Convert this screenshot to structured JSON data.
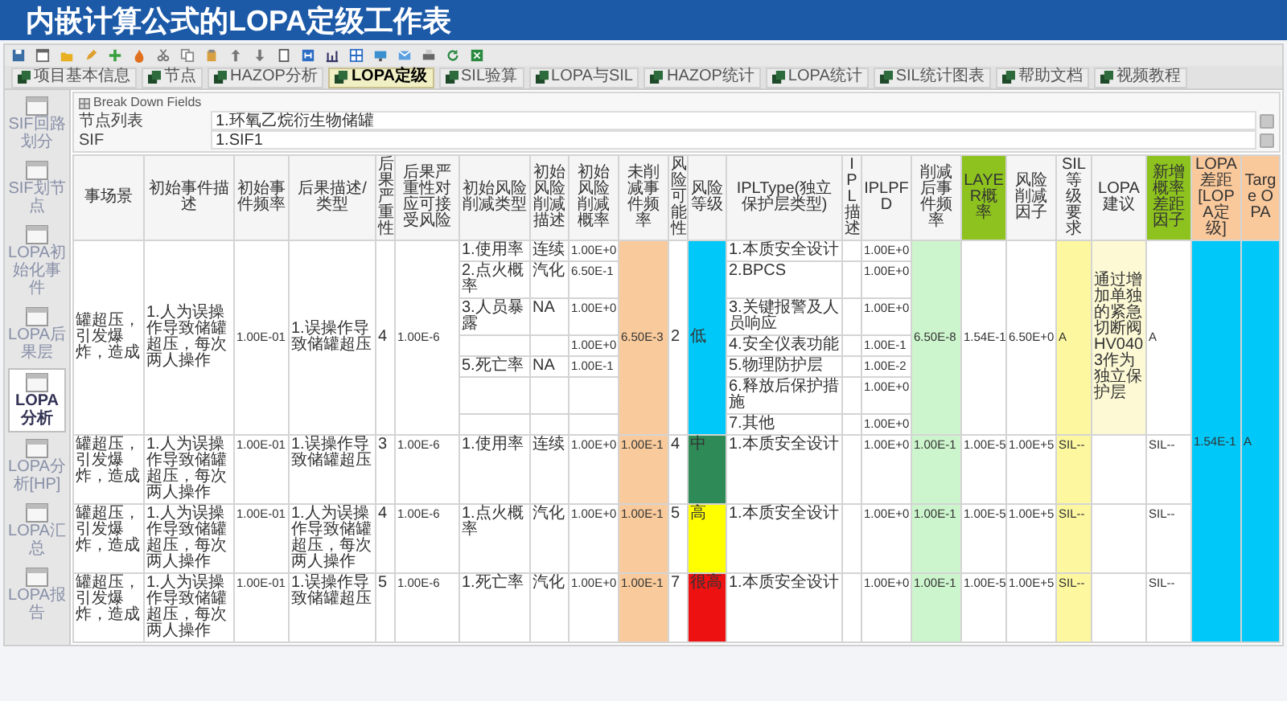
{
  "title": "内嵌计算公式的LOPA定级工作表",
  "tabs": [
    {
      "label": "项目基本信息",
      "selected": false
    },
    {
      "label": "节点",
      "selected": false
    },
    {
      "label": "HAZOP分析",
      "selected": false
    },
    {
      "label": "LOPA定级",
      "selected": true
    },
    {
      "label": "SIL验算",
      "selected": false
    },
    {
      "label": "LOPA与SIL",
      "selected": false
    },
    {
      "label": "HAZOP统计",
      "selected": false
    },
    {
      "label": "LOPA统计",
      "selected": false
    },
    {
      "label": "SIL统计图表",
      "selected": false
    },
    {
      "label": "帮助文档",
      "selected": false
    },
    {
      "label": "视频教程",
      "selected": false
    }
  ],
  "sidebar": {
    "items": [
      {
        "label": "SIF回路划分",
        "selected": false
      },
      {
        "label": "SIF划节点",
        "selected": false
      },
      {
        "label": "LOPA初始化事件",
        "selected": false
      },
      {
        "label": "LOPA后果层",
        "selected": false
      },
      {
        "label": "LOPA分析",
        "selected": true
      },
      {
        "label": "LOPA分析[HP]",
        "selected": false
      },
      {
        "label": "LOPA汇总",
        "selected": false
      },
      {
        "label": "LOPA报告",
        "selected": false
      }
    ]
  },
  "breakdown": {
    "title": "Break Down Fields",
    "fields": [
      {
        "label": "节点列表",
        "value": "1.环氧乙烷衍生物储罐"
      },
      {
        "label": "SIF",
        "value": "1.SIF1"
      }
    ]
  },
  "table": {
    "columns": [
      {
        "label": "事场景",
        "kind": "text"
      },
      {
        "label": "初始事件描述",
        "kind": "text"
      },
      {
        "label": "初始事件频率",
        "kind": "number"
      },
      {
        "label": "后果描述/类型",
        "kind": "text"
      },
      {
        "label": "后果严重性",
        "kind": "text"
      },
      {
        "label": "后果严重性对应可接受风险",
        "kind": "number"
      },
      {
        "label": "初始风险削减类型",
        "kind": "text"
      },
      {
        "label": "初始风险削减描述",
        "kind": "text"
      },
      {
        "label": "初始风险削减概率",
        "kind": "number"
      },
      {
        "label": "未削减事件频率",
        "kind": "unmitigated"
      },
      {
        "label": "风险可能性",
        "kind": "text"
      },
      {
        "label": "风险等级",
        "kind": "risk"
      },
      {
        "label": "IPLType(独立保护层类型)",
        "kind": "text"
      },
      {
        "label": "IPL描述",
        "kind": "text"
      },
      {
        "label": "IPLPFD",
        "kind": "number"
      },
      {
        "label": "削减后事件频率",
        "kind": "mitigated"
      },
      {
        "label": "LAYER概率",
        "kind": "flag"
      },
      {
        "label": "风险削减因子",
        "kind": "number"
      },
      {
        "label": "SIL等级要求",
        "kind": "sil"
      },
      {
        "label": "LOPA建议",
        "kind": "advice"
      },
      {
        "label": "新增概率差距因子",
        "kind": "flag"
      },
      {
        "label": "LOPA差距[LOPA定级]",
        "kind": "gap"
      },
      {
        "label": "Targe OPA",
        "kind": "gap"
      }
    ],
    "rows": [
      {
        "scenario": "罐超压，引发爆炸，造成",
        "initiating_event": "1.人为误操作导致储罐超压，每次两人操作",
        "frequency": "1.00E-01",
        "consequence": "1.误操作导致储罐超压",
        "severity": "4",
        "acceptable_risk": "1.00E-6",
        "mitigations": [
          {
            "type": "1.使用率",
            "description": "连续",
            "probability": "1.00E+0"
          },
          {
            "type": "2.点火概率",
            "description": "汽化",
            "probability": "6.50E-1"
          },
          {
            "type": "3.人员暴露",
            "description": "NA",
            "probability": "1.00E+0"
          },
          {
            "probability": "1.00E+0"
          },
          {
            "type": "5.死亡率",
            "description": "NA",
            "probability": "1.00E-1"
          }
        ],
        "unmitigated_frequency": "6.50E-3",
        "likelihood": "2",
        "risk_level": {
          "label": "低",
          "color": "#00c8f8"
        },
        "ipls": [
          {
            "type": "1.本质安全设计",
            "pfd": "1.00E+0"
          },
          {
            "type": "2.BPCS",
            "pfd": "1.00E+0"
          },
          {
            "type": "3.关键报警及人员响应",
            "pfd": "1.00E+0"
          },
          {
            "type": "4.安全仪表功能",
            "pfd": "1.00E-1"
          },
          {
            "type": "5.物理防护层",
            "pfd": "1.00E-2"
          },
          {
            "type": "6.释放后保护措施",
            "pfd": "1.00E+0"
          },
          {
            "type": "7.其他",
            "pfd": "1.00E+0"
          }
        ],
        "mitigated_frequency": "6.50E-8",
        "column_17": "1.54E-1",
        "risk_reduction_factor": "6.50E+0",
        "sil": "A",
        "advice": "通过增加单独的紧急切断阀HV0403作为独立保护层",
        "column_21": "A"
      },
      {
        "scenario": "罐超压，引发爆炸，造成",
        "initiating_event": "1.人为误操作导致储罐超压，每次两人操作",
        "frequency": "1.00E-01",
        "consequence": "1.误操作导致储罐超压",
        "severity": "3",
        "acceptable_risk": "1.00E-6",
        "mitigations": [
          {
            "type": "1.使用率",
            "description": "连续",
            "probability": "1.00E+0"
          }
        ],
        "unmitigated_frequency": "1.00E-1",
        "likelihood": "4",
        "risk_level": {
          "label": "中",
          "color": "#2e8b57"
        },
        "ipls": [
          {
            "type": "1.本质安全设计",
            "pfd": "1.00E+0"
          }
        ],
        "mitigated_frequency": "1.00E-1",
        "column_17": "1.00E-5",
        "risk_reduction_factor": "1.00E+5",
        "sil": "SIL--",
        "column_21": "SIL--"
      },
      {
        "scenario": "罐超压，引发爆炸，造成",
        "initiating_event": "1.人为误操作导致储罐超压，每次两人操作",
        "frequency": "1.00E-01",
        "consequence": "1.人为误操作导致储罐超压，每次两人操作",
        "severity": "4",
        "acceptable_risk": "1.00E-6",
        "mitigations": [
          {
            "type": "1.点火概率",
            "description": "汽化",
            "probability": "1.00E+0"
          }
        ],
        "unmitigated_frequency": "1.00E-1",
        "likelihood": "5",
        "risk_level": {
          "label": "高",
          "color": "#ffff00"
        },
        "ipls": [
          {
            "type": "1.本质安全设计",
            "pfd": "1.00E+0"
          }
        ],
        "mitigated_frequency": "1.00E-1",
        "column_17": "1.00E-5",
        "risk_reduction_factor": "1.00E+5",
        "sil": "SIL--",
        "column_21": "SIL--"
      },
      {
        "scenario": "罐超压，引发爆炸，造成",
        "initiating_event": "1.人为误操作导致储罐超压，每次两人操作",
        "frequency": "1.00E-01",
        "consequence": "1.误操作导致储罐超压",
        "severity": "5",
        "acceptable_risk": "1.00E-6",
        "mitigations": [
          {
            "type": "1.死亡率",
            "description": "汽化",
            "probability": "1.00E+0"
          }
        ],
        "unmitigated_frequency": "1.00E-1",
        "likelihood": "7",
        "risk_level": {
          "label": "很高",
          "color": "#ee1111"
        },
        "ipls": [
          {
            "type": "1.本质安全设计",
            "pfd": "1.00E+0"
          }
        ],
        "mitigated_frequency": "1.00E-1",
        "column_17": "1.00E-5",
        "risk_reduction_factor": "1.00E+5",
        "sil": "SIL--",
        "column_21": "SIL--"
      }
    ],
    "summary": {
      "lopa_gap": "1.54E-1",
      "target": "A"
    }
  }
}
